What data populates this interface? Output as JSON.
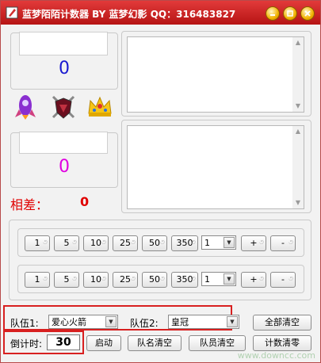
{
  "window": {
    "title": "蓝梦陌陌计数器 BY 蓝梦幻影 QQ：316483827"
  },
  "team1": {
    "score": "0",
    "score_color": "#1a1ad0"
  },
  "team2": {
    "score": "0",
    "score_color": "#e000e0"
  },
  "icons": [
    "rocket-icon",
    "shield-swords-icon",
    "crown-icon"
  ],
  "difference": {
    "label": "相差：",
    "value": "0"
  },
  "counter_rows": [
    {
      "buttons": [
        "1",
        "5",
        "10",
        "25",
        "50",
        "350"
      ],
      "select_value": "1",
      "plus": "+",
      "minus": "-"
    },
    {
      "buttons": [
        "1",
        "5",
        "10",
        "25",
        "50",
        "350"
      ],
      "select_value": "1",
      "plus": "+",
      "minus": "-"
    }
  ],
  "teams_bar": {
    "team1_label": "队伍1:",
    "team1_value": "爱心火箭",
    "team2_label": "队伍2:",
    "team2_value": "皇冠",
    "clear_all": "全部清空"
  },
  "timer_bar": {
    "label": "倒计时:",
    "value": "30",
    "start": "启动",
    "clear_names": "队名清空",
    "clear_members": "队员清空",
    "clear_count": "计数清零"
  },
  "watermark": "www.downcc.com"
}
